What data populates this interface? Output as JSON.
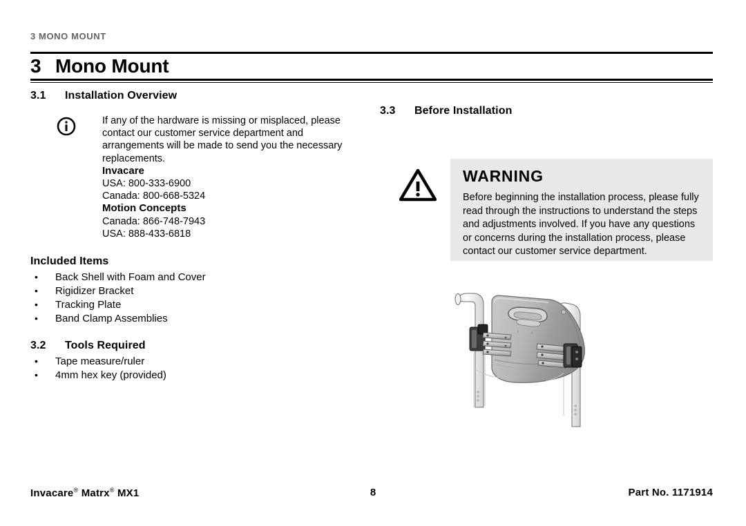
{
  "running_header": "3 MONO MOUNT",
  "chapter": {
    "number": "3",
    "title": "Mono Mount"
  },
  "sections": {
    "installation_overview": {
      "number": "3.1",
      "title": "Installation Overview",
      "icon": "info-icon",
      "note_paragraph": "If any of the hardware is missing or misplaced, please contact our customer service department and arrangements will be made to send you the necessary replacements.",
      "contacts": [
        {
          "company": "Invacare",
          "lines": [
            "USA: 800-333-6900",
            "Canada: 800-668-5324"
          ]
        },
        {
          "company": "Motion Concepts",
          "lines": [
            "Canada: 866-748-7943",
            "USA: 888-433-6818"
          ]
        }
      ],
      "included_items_title": "Included Items",
      "included_items": [
        "Back Shell with Foam and Cover",
        "Rigidizer Bracket",
        "Tracking Plate",
        "Band Clamp Assemblies"
      ]
    },
    "tools_required": {
      "number": "3.2",
      "title": "Tools Required",
      "items": [
        "Tape measure/ruler",
        "4mm hex key (provided)"
      ]
    },
    "before_installation": {
      "number": "3.3",
      "title": "Before Installation",
      "warning": {
        "icon": "warning-triangle-icon",
        "title": "WARNING",
        "text": "Before beginning the installation process, please fully read through the instructions to understand the steps and adjustments involved. If you have any questions or concerns during the installation process, please contact our customer service department.",
        "background_color": "#e8e8e8"
      }
    }
  },
  "illustration": {
    "caption": "",
    "alt": "Mono mount back support assembly mounted on wheelchair canes"
  },
  "footer": {
    "left_product": "Invacare",
    "left_brand": "Matrx",
    "left_model": "MX1",
    "registered_mark": "®",
    "page_number": "8",
    "part_label": "Part No.",
    "part_number": "1171914"
  },
  "colors": {
    "header_gray": "#636363",
    "warning_bg": "#e8e8e8",
    "rule": "#000000"
  }
}
